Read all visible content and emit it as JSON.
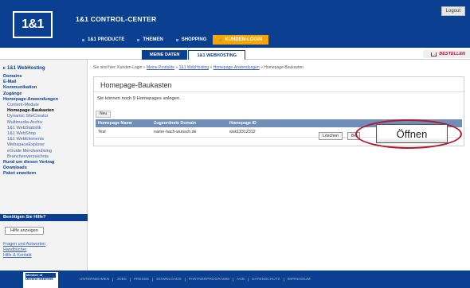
{
  "header": {
    "logo": "1&1",
    "title": "1&1 CONTROL-CENTER",
    "logout": "Logout",
    "nav": [
      {
        "label": "1&1 PRODUCTE",
        "active": false
      },
      {
        "label": "THEMEN",
        "active": false
      },
      {
        "label": "SHOPPING",
        "active": false
      },
      {
        "label": "KUNDEN-LOGIN",
        "active": true
      }
    ]
  },
  "subnav": {
    "tabs": [
      {
        "label": "MEINE DATEN",
        "active": false
      },
      {
        "label": "1&1 WEBHOSTING",
        "active": true
      }
    ],
    "order_label": "BESTELLEN"
  },
  "sidebar": {
    "header": "1&1 WebHosting",
    "main_items": [
      "Domains",
      "E-Mail",
      "Kommunikation",
      "Zugänge",
      "Homepage-Anwendungen"
    ],
    "sub_items": [
      {
        "label": "Content-Module",
        "current": false
      },
      {
        "label": "Homepage-Baukasten",
        "current": true
      },
      {
        "label": "Dynamic SiteCreator",
        "current": false
      },
      {
        "label": "Multimedia-Archiv",
        "current": false
      },
      {
        "label": "1&1 WebStatistik",
        "current": false
      },
      {
        "label": "1&1 WebShop",
        "current": false
      },
      {
        "label": "1&1 WebElements",
        "current": false
      },
      {
        "label": "WebspaceExplorer",
        "current": false
      },
      {
        "label": "eGuide Merchandising",
        "current": false
      },
      {
        "label": "Branchenverzeichnis",
        "current": false
      }
    ],
    "bottom_items": [
      "Rund um diesen Vertrag",
      "Downloads",
      "Paket erweitern"
    ],
    "help_header": "Benötigen Sie Hilfe?",
    "help_button": "Hilfe anzeigen",
    "links": [
      "Fragen und Antworten",
      "Handbücher",
      "Hilfe & Kontakt"
    ]
  },
  "breadcrumb": {
    "prefix": "Sie sind hier: Kunden-Login »",
    "links": [
      "Meine Produkte",
      "1&1 WebHosting",
      "Homepage-Anwendungen"
    ],
    "current": "Homepage-Baukasten"
  },
  "main": {
    "title": "Homepage-Baukasten",
    "info": "Sie können noch 9 Homepages anlegen.",
    "new_tab": "Neu",
    "columns": [
      "Homepage Name",
      "Zugeordnete Domain",
      "Homepage ID"
    ],
    "row": {
      "name": "Test",
      "domain": "name-nach-wunsch.de",
      "id": "wsk12312312",
      "delete": "Löschen",
      "edit": "Be"
    },
    "open_button": "Öffnen"
  },
  "footer": {
    "badge_top": "Member of",
    "badge_name": "united internet",
    "links": [
      "UNTERNEHMEN",
      "JOBS",
      "PRESSE",
      "DOWNLOADS",
      "PARTNERPROGRAMM",
      "AGB",
      "DATENSCHUTZ",
      "IMPRESSUM"
    ]
  },
  "colors": {
    "brand_blue": "#0b3f8f",
    "active_orange": "#f7a600",
    "highlight_red": "#b5152d"
  }
}
